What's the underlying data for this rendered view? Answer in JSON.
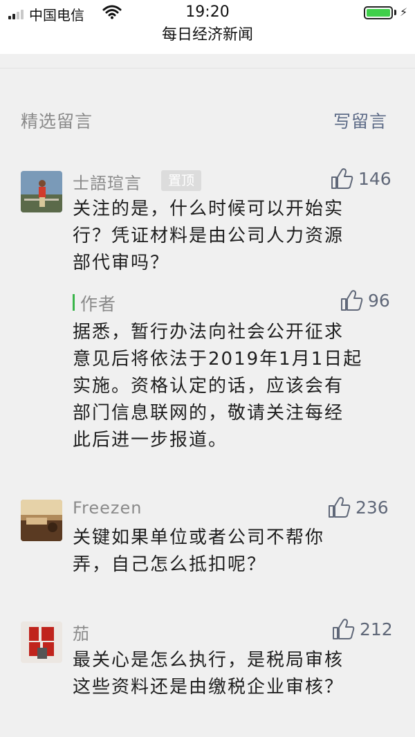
{
  "status_bar": {
    "carrier": "中国电信",
    "time": "19:20"
  },
  "nav": {
    "title": "每日经济新闻"
  },
  "section": {
    "title": "精选留言",
    "write_label": "写留言"
  },
  "comments": [
    {
      "username": "士語瑄言",
      "pinned_label": "置顶",
      "likes": "146",
      "text": [
        "关注的是，什么时候可以开始实",
        "行？凭证材料是由公司人力资源",
        "部代审吗？"
      ],
      "reply": {
        "author_label": "作者",
        "likes": "96",
        "text": [
          "据悉，暂行办法向社会公开征求",
          "意见后将依法于2019年1月1日起",
          "实施。资格认定的话，应该会有",
          "部门信息联网的，敬请关注每经",
          "此后进一步报道。"
        ]
      }
    },
    {
      "username": "Freezen",
      "likes": "236",
      "text": [
        "关键如果单位或者公司不帮你",
        "弄，自己怎么抵扣呢？"
      ]
    },
    {
      "username": "茄",
      "likes": "212",
      "text": [
        "最关心是怎么执行，是税局审核",
        "这些资料还是由缴税企业审核？"
      ]
    }
  ]
}
